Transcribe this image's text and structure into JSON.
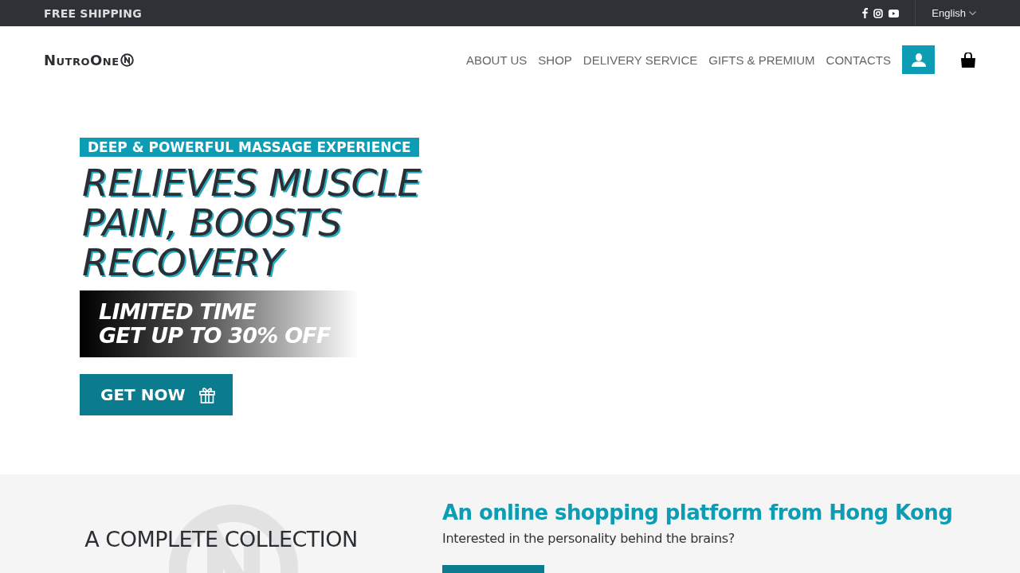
{
  "top_bar": {
    "promo": "FREE SHIPPING",
    "language": "English"
  },
  "header": {
    "logo": "NutroOne",
    "nav": [
      {
        "label": "ABOUT US"
      },
      {
        "label": "SHOP"
      },
      {
        "label": "DELIVERY SERVICE"
      },
      {
        "label": "GIFTS & PREMIUM"
      },
      {
        "label": "CONTACTS"
      }
    ]
  },
  "hero": {
    "tagline": "DEEP & POWERFUL MASSAGE EXPERIENCE",
    "headline": [
      "RELIEVES MUSCLE",
      "PAIN, BOOSTS",
      "RECOVERY"
    ],
    "offer": [
      "LIMITED TIME",
      "GET UP TO 30% OFF"
    ],
    "cta": "GET NOW"
  },
  "intro": {
    "collection_heading": [
      "A COMPLETE COLLECTION"
    ],
    "title": "An online shopping platform from Hong Kong",
    "subtitle": "Interested in the personality behind the brains?"
  }
}
